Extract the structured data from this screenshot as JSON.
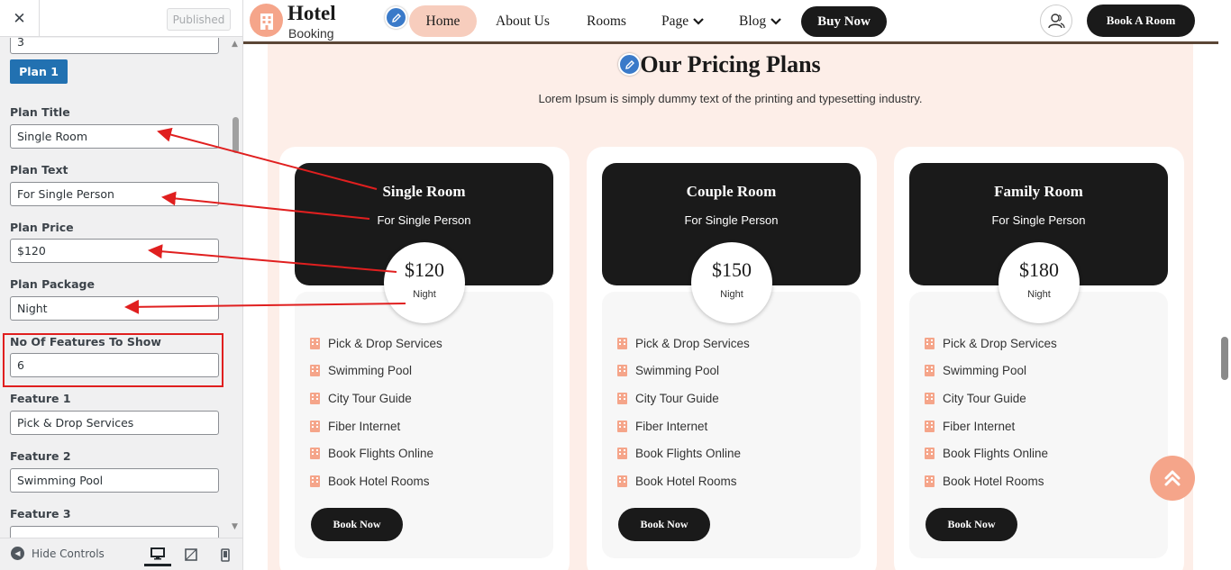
{
  "sidebar": {
    "close_label": "✕",
    "published_label": "Published",
    "partial_value": "3",
    "plan_button": "Plan 1",
    "fields": {
      "plan_title": {
        "label": "Plan Title",
        "value": "Single Room"
      },
      "plan_text": {
        "label": "Plan Text",
        "value": "For Single Person"
      },
      "plan_price": {
        "label": "Plan Price",
        "value": "$120"
      },
      "plan_package": {
        "label": "Plan Package",
        "value": "Night"
      },
      "features_count": {
        "label": "No Of Features To Show",
        "value": "6"
      },
      "feature1": {
        "label": "Feature 1",
        "value": "Pick & Drop Services"
      },
      "feature2": {
        "label": "Feature 2",
        "value": "Swimming Pool"
      },
      "feature3": {
        "label": "Feature 3",
        "value": ""
      }
    },
    "footer": {
      "hide_controls": "Hide Controls"
    }
  },
  "header": {
    "logo_title": "Hotel",
    "logo_sub": "Booking",
    "nav": {
      "home": "Home",
      "about": "About Us",
      "rooms": "Rooms",
      "page": "Page",
      "blog": "Blog",
      "buy_now": "Buy Now"
    },
    "book_room": "Book A Room"
  },
  "pricing": {
    "title": "Our Pricing Plans",
    "subtitle": "Lorem Ipsum is simply dummy text of the printing and typesetting industry.",
    "plans": [
      {
        "title": "Single Room",
        "text": "For Single Person",
        "price": "$120",
        "package": "Night",
        "features": [
          "Pick & Drop Services",
          "Swimming Pool",
          "City Tour Guide",
          "Fiber Internet",
          "Book Flights Online",
          "Book Hotel Rooms"
        ],
        "button": "Book Now"
      },
      {
        "title": "Couple Room",
        "text": "For Single Person",
        "price": "$150",
        "package": "Night",
        "features": [
          "Pick & Drop Services",
          "Swimming Pool",
          "City Tour Guide",
          "Fiber Internet",
          "Book Flights Online",
          "Book Hotel Rooms"
        ],
        "button": "Book Now"
      },
      {
        "title": "Family Room",
        "text": "For Single Person",
        "price": "$180",
        "package": "Night",
        "features": [
          "Pick & Drop Services",
          "Swimming Pool",
          "City Tour Guide",
          "Fiber Internet",
          "Book Flights Online",
          "Book Hotel Rooms"
        ],
        "button": "Book Now"
      }
    ]
  },
  "colors": {
    "accent": "#f5a58a",
    "dark": "#1a1a1a",
    "section_bg": "#fdeee8",
    "wp_blue": "#2271b1",
    "annotation": "#e01f1f"
  },
  "icons": [
    "close-icon",
    "pencil-icon",
    "chevron-down-icon",
    "user-icon",
    "building-icon",
    "double-chevron-up-icon",
    "desktop-icon",
    "tablet-icon",
    "mobile-icon",
    "arrow-left-circle-icon"
  ]
}
